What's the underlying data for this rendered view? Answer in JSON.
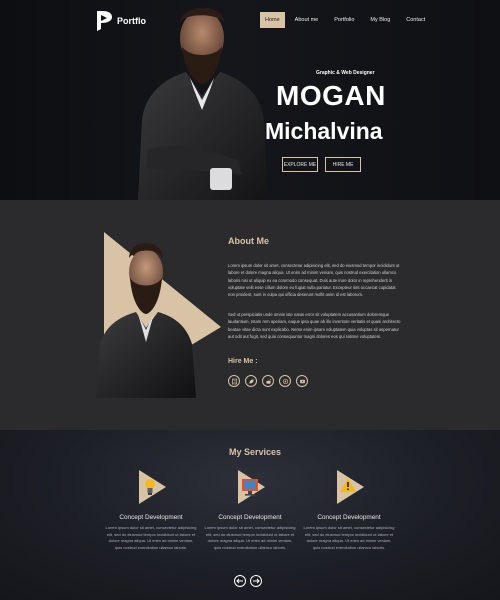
{
  "brand": {
    "name": "Portflo"
  },
  "nav": {
    "items": [
      "Home",
      "About me",
      "Portfolio",
      "My Blog",
      "Contact"
    ],
    "active": "Home"
  },
  "hero": {
    "subtitle": "Graphic & Web Designer",
    "name_line1": "MOGAN",
    "name_line2": "Michalvina",
    "explore_label": "EXPLORE ME",
    "hire_label": "HIRE ME"
  },
  "about": {
    "title": "About Me",
    "paragraph1": "Lorem ipsum dolor sit amet, consectetur adipisicing elit, sed do eiusmod tempor incididunt ut labore et dolore magna aliqua. Ut enim ad minim veniam, quis nostrud exercitation ullamco laboris nisi ut aliquip ex ea commodo consequat. Duis aute irure dolor in reprehenderit in voluptate velit esse cillum dolore eu fugiat nulla pariatur. Excepteur sint occaecat cupidatat non proident, sunt in culpa qui officia deserunt mollit anim id est laborum.",
    "paragraph2": "Sed ut perspiciatis unde omnis iste natus error sit voluptatem accusantium doloremque laudantium, totam rem aperiam, eaque ipsa quae ab illo inventore veritatis et quasi architecto beatae vitae dicta sunt explicabo. Nemo enim ipsam voluptatem quia voluptas sit aspernatur aut odit aut fugit, sed quia consequuntur magni dolores eos qui ratione voluptatem.",
    "hire_title": "Hire Me :",
    "socials": [
      "freelancer-icon",
      "leaf-icon",
      "reddit-icon",
      "at-icon",
      "youtube-icon"
    ]
  },
  "services": {
    "title": "My Services",
    "items": [
      {
        "name": "Concept Development",
        "desc": "Lorem ipsum dolor sit amet, consectetur adipisicing elit, sed do eiusmod tempor incididunt ut labore et dolore magna aliqua. Ut enim ad minim veniam, quis nostrud exercitation ullamco laboris.",
        "icon": "lightbulb-icon"
      },
      {
        "name": "Concept Development",
        "desc": "Lorem ipsum dolor sit amet, consectetur adipisicing elit, sed do eiusmod tempor incididunt ut labore et dolore magna aliqua. Ut enim ad minim veniam, quis nostrud exercitation ullamco laboris.",
        "icon": "monitor-icon"
      },
      {
        "name": "Concept Development",
        "desc": "Lorem ipsum dolor sit amet, consectetur adipisicing elit, sed do eiusmod tempor incididunt ut labore et dolore magna aliqua. Ut enim ad minim veniam, quis nostrud exercitation ullamco laboris.",
        "icon": "warning-icon"
      }
    ]
  },
  "colors": {
    "accent": "#d9c3a6",
    "hero_bg": "#111217",
    "about_bg": "#2b2b2d",
    "services_bg": "#1d1f26"
  }
}
